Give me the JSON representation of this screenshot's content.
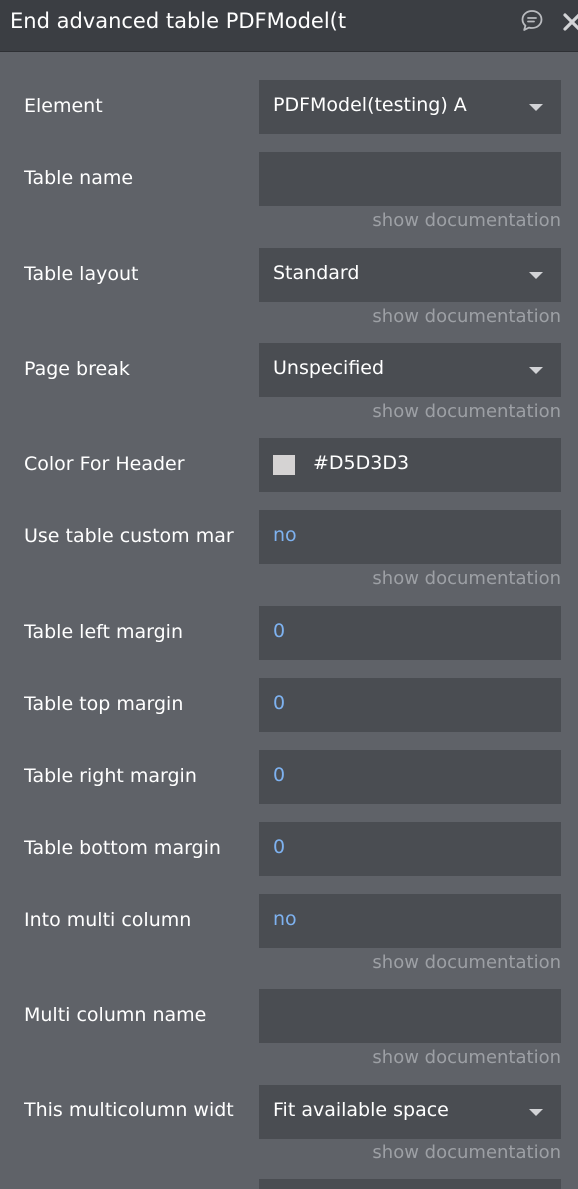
{
  "header": {
    "title": "End advanced table PDFModel(t"
  },
  "doc_link": "show documentation",
  "rows": [
    {
      "label": "Element",
      "value": "PDFModel(testing) A"
    },
    {
      "label": "Table name",
      "value": ""
    },
    {
      "label": "Table layout",
      "value": "Standard"
    },
    {
      "label": "Page break",
      "value": "Unspecified"
    },
    {
      "label": "Color For Header",
      "value": "#D5D3D3",
      "color": "#D5D3D3"
    },
    {
      "label": "Use table custom mar",
      "value": "no"
    },
    {
      "label": "Table left margin",
      "value": "0"
    },
    {
      "label": "Table top margin",
      "value": "0"
    },
    {
      "label": "Table right margin",
      "value": "0"
    },
    {
      "label": "Table bottom margin",
      "value": "0"
    },
    {
      "label": "Into multi column",
      "value": "no"
    },
    {
      "label": "Multi column name",
      "value": ""
    },
    {
      "label": "This multicolumn widt",
      "value": "Fit available space"
    }
  ]
}
